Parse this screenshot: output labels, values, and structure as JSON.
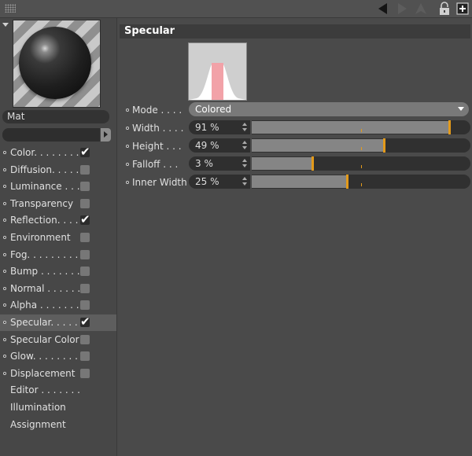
{
  "toolbar": {
    "icons": [
      "grip-icon",
      "arrow-left-icon",
      "arrow-right-icon",
      "up-icon",
      "lock-icon",
      "new-window-icon"
    ]
  },
  "material": {
    "name": "Mat",
    "filter": ""
  },
  "channels": [
    {
      "label": "Color. . . . . . . .",
      "dot": true,
      "checkbox": true,
      "checked": true,
      "selected": false
    },
    {
      "label": "Diffusion. . . . .",
      "dot": true,
      "checkbox": true,
      "checked": false,
      "selected": false
    },
    {
      "label": "Luminance . . .",
      "dot": true,
      "checkbox": true,
      "checked": false,
      "selected": false
    },
    {
      "label": "Transparency",
      "dot": true,
      "checkbox": true,
      "checked": false,
      "selected": false
    },
    {
      "label": "Reflection. . . .",
      "dot": true,
      "checkbox": true,
      "checked": true,
      "selected": false
    },
    {
      "label": "Environment",
      "dot": true,
      "checkbox": true,
      "checked": false,
      "selected": false
    },
    {
      "label": "Fog. . . . . . . . .",
      "dot": true,
      "checkbox": true,
      "checked": false,
      "selected": false
    },
    {
      "label": "Bump . . . . . . .",
      "dot": true,
      "checkbox": true,
      "checked": false,
      "selected": false
    },
    {
      "label": "Normal . . . . . .",
      "dot": true,
      "checkbox": true,
      "checked": false,
      "selected": false
    },
    {
      "label": "Alpha . . . . . . .",
      "dot": true,
      "checkbox": true,
      "checked": false,
      "selected": false
    },
    {
      "label": "Specular. . . . .",
      "dot": true,
      "checkbox": true,
      "checked": true,
      "selected": true
    },
    {
      "label": "Specular Color",
      "dot": true,
      "checkbox": true,
      "checked": false,
      "selected": false
    },
    {
      "label": "Glow. . . . . . . .",
      "dot": true,
      "checkbox": true,
      "checked": false,
      "selected": false
    },
    {
      "label": "Displacement",
      "dot": true,
      "checkbox": true,
      "checked": false,
      "selected": false
    },
    {
      "label": "Editor . . . . . . .",
      "dot": false,
      "checkbox": false,
      "checked": false,
      "selected": false
    },
    {
      "label": "Illumination",
      "dot": false,
      "checkbox": false,
      "checked": false,
      "selected": false
    },
    {
      "label": "Assignment",
      "dot": false,
      "checkbox": false,
      "checked": false,
      "selected": false
    }
  ],
  "specular": {
    "title": "Specular",
    "mode_label": "Mode . . . .",
    "mode_value": "Colored",
    "params": [
      {
        "name": "width",
        "label": "Width . . . .",
        "value": "91 %",
        "fraction": 0.91
      },
      {
        "name": "height",
        "label": "Height . . .",
        "value": "49 %",
        "fraction": 0.49
      },
      {
        "name": "falloff",
        "label": "Falloff . . .",
        "value": "3 %",
        "fraction": 0.03
      },
      {
        "name": "inner-width",
        "label": "Inner Width",
        "value": "25 %",
        "fraction": 0.25
      }
    ]
  },
  "colors": {
    "accent_handle": "#e39a1a",
    "curve_fill": "#ffffff",
    "curve_highlight": "#f2a2a8"
  }
}
